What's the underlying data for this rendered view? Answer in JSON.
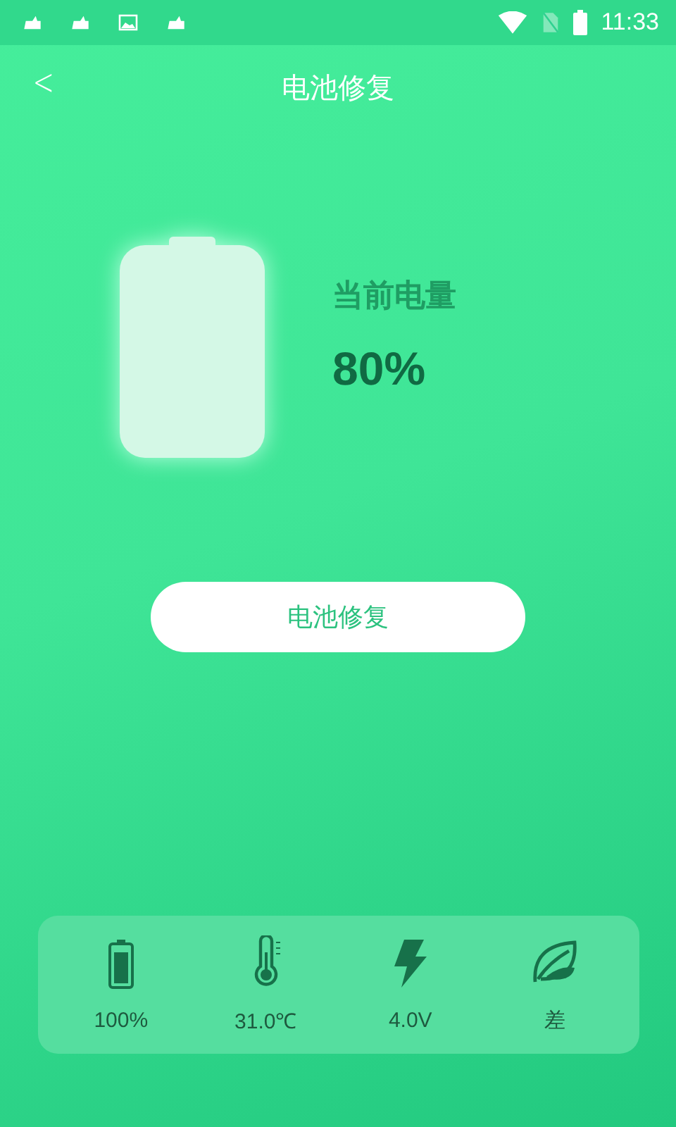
{
  "status_bar": {
    "time": "11:33"
  },
  "header": {
    "back": "<",
    "title": "电池修复"
  },
  "battery": {
    "label": "当前电量",
    "value": "80%"
  },
  "repair_button": "电池修复",
  "stats": [
    {
      "kind": "battery",
      "value": "100%"
    },
    {
      "kind": "temperature",
      "value": "31.0℃"
    },
    {
      "kind": "voltage",
      "value": "4.0V"
    },
    {
      "kind": "health",
      "value": "差"
    }
  ]
}
